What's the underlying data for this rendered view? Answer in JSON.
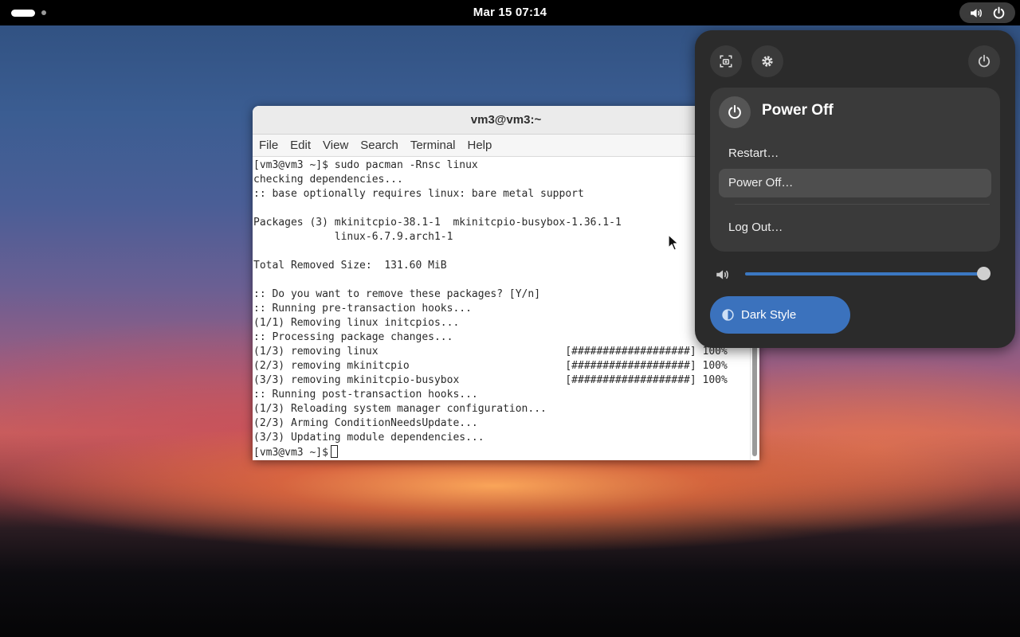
{
  "topbar": {
    "clock": "Mar 15  07:14",
    "icons": [
      "volume-icon",
      "power-icon"
    ]
  },
  "terminal": {
    "title": "vm3@vm3:~",
    "menu": [
      "File",
      "Edit",
      "View",
      "Search",
      "Terminal",
      "Help"
    ],
    "lines": [
      "[vm3@vm3 ~]$ sudo pacman -Rnsc linux",
      "checking dependencies...",
      ":: base optionally requires linux: bare metal support",
      "",
      "Packages (3) mkinitcpio-38.1-1  mkinitcpio-busybox-1.36.1-1",
      "             linux-6.7.9.arch1-1",
      "",
      "Total Removed Size:  131.60 MiB",
      "",
      ":: Do you want to remove these packages? [Y/n]",
      ":: Running pre-transaction hooks...",
      "(1/1) Removing linux initcpios...",
      ":: Processing package changes...",
      "(1/3) removing linux                              [###################] 100%",
      "(2/3) removing mkinitcpio                         [###################] 100%",
      "(3/3) removing mkinitcpio-busybox                 [###################] 100%",
      ":: Running post-transaction hooks...",
      "(1/3) Reloading system manager configuration...",
      "(2/3) Arming ConditionNeedsUpdate...",
      "(3/3) Updating module dependencies..."
    ],
    "prompt": "[vm3@vm3 ~]$"
  },
  "quick_settings": {
    "power_menu": {
      "title": "Power Off",
      "items": [
        "Restart…",
        "Power Off…",
        "Log Out…"
      ],
      "highlighted": "Power Off…"
    },
    "volume_level": 1.0,
    "dark_style_label": "Dark Style",
    "accent_color": "#3b72bd"
  }
}
